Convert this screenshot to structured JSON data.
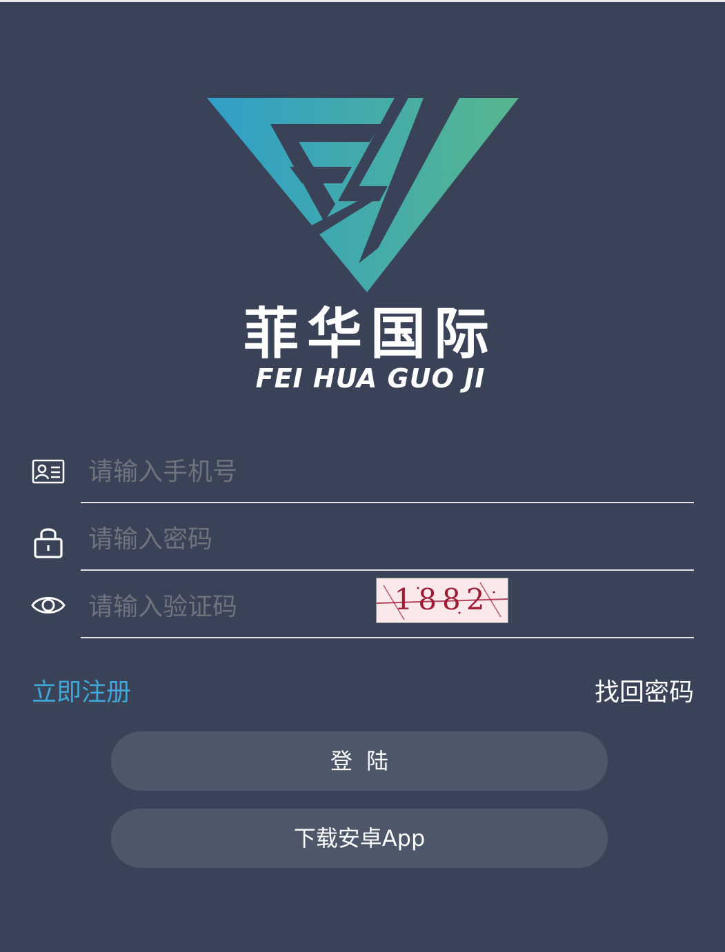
{
  "brand": {
    "name_cn": "菲华国际",
    "name_en": "FEI HUA GUO JI",
    "logo_gradient_start": "#2f9fc8",
    "logo_gradient_end": "#57b68e"
  },
  "form": {
    "phone": {
      "icon": "id-card-icon",
      "placeholder": "请输入手机号",
      "value": ""
    },
    "password": {
      "icon": "lock-icon",
      "placeholder": "请输入密码",
      "value": ""
    },
    "captcha": {
      "icon": "eye-icon",
      "placeholder": "请输入验证码",
      "value": "",
      "image_text": "1882"
    }
  },
  "links": {
    "register": "立即注册",
    "find_password": "找回密码"
  },
  "buttons": {
    "login": "登  陆",
    "download": "下载安卓App"
  },
  "colors": {
    "background": "#394257",
    "button": "#4e5769",
    "link_accent": "#3ea8db",
    "placeholder": "#6f737c"
  }
}
